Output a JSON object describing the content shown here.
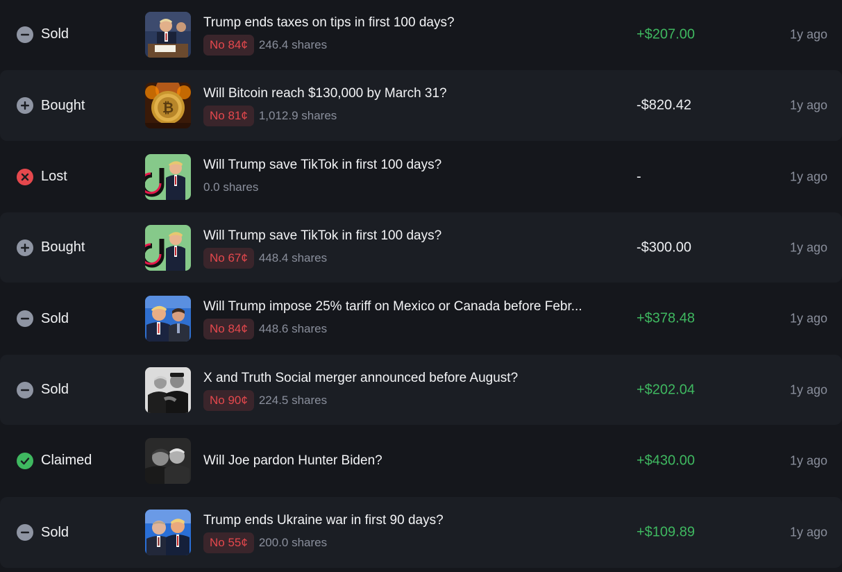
{
  "colors": {
    "background": "#15171c",
    "row_alt": "#1b1e24",
    "positive": "#3fb860",
    "negative_badge": "#e5484d",
    "muted": "#8a8f9c"
  },
  "activity": [
    {
      "action": "Sold",
      "icon": "minus-circle-icon",
      "title": "Trump ends taxes on tips in first 100 days?",
      "outcome": "No 84¢",
      "shares": "246.4 shares",
      "amount": "+$207.00",
      "amount_type": "pos",
      "time": "1y ago",
      "thumb": "trump-signing-thumbnail"
    },
    {
      "action": "Bought",
      "icon": "plus-circle-icon",
      "title": "Will Bitcoin reach $130,000 by March 31?",
      "outcome": "No 81¢",
      "shares": "1,012.9 shares",
      "amount": "-$820.42",
      "amount_type": "neg",
      "time": "1y ago",
      "thumb": "bitcoin-thumbnail"
    },
    {
      "action": "Lost",
      "icon": "x-circle-icon",
      "title": "Will Trump save TikTok in first 100 days?",
      "outcome": "",
      "shares": "0.0 shares",
      "amount": "-",
      "amount_type": "none",
      "time": "1y ago",
      "thumb": "tiktok-trump-thumbnail"
    },
    {
      "action": "Bought",
      "icon": "plus-circle-icon",
      "title": "Will Trump save TikTok in first 100 days?",
      "outcome": "No 67¢",
      "shares": "448.4 shares",
      "amount": "-$300.00",
      "amount_type": "neg",
      "time": "1y ago",
      "thumb": "tiktok-trump-thumbnail"
    },
    {
      "action": "Sold",
      "icon": "minus-circle-icon",
      "title": "Will Trump impose 25% tariff on Mexico or Canada before Febr...",
      "outcome": "No 84¢",
      "shares": "448.6 shares",
      "amount": "+$378.48",
      "amount_type": "pos",
      "time": "1y ago",
      "thumb": "trump-trudeau-thumbnail"
    },
    {
      "action": "Sold",
      "icon": "minus-circle-icon",
      "title": "X and Truth Social merger announced before August?",
      "outcome": "No 90¢",
      "shares": "224.5 shares",
      "amount": "+$202.04",
      "amount_type": "pos",
      "time": "1y ago",
      "thumb": "trump-musk-thumbnail"
    },
    {
      "action": "Claimed",
      "icon": "check-circle-icon",
      "title": "Will Joe pardon Hunter Biden?",
      "outcome": "",
      "shares": "",
      "amount": "+$430.00",
      "amount_type": "pos",
      "time": "1y ago",
      "thumb": "biden-thumbnail"
    },
    {
      "action": "Sold",
      "icon": "minus-circle-icon",
      "title": "Trump ends Ukraine war in first 90 days?",
      "outcome": "No 55¢",
      "shares": "200.0 shares",
      "amount": "+$109.89",
      "amount_type": "pos",
      "time": "1y ago",
      "thumb": "putin-trump-thumbnail"
    }
  ]
}
